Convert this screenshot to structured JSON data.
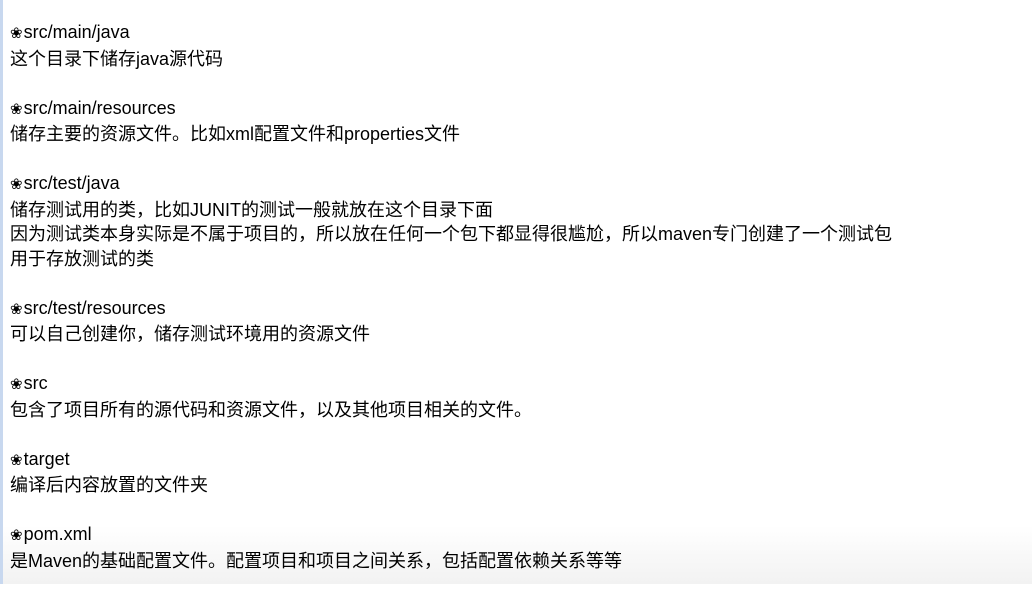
{
  "bullet_icon": "❀",
  "sections": [
    {
      "title": "src/main/java",
      "lines": [
        "这个目录下储存java源代码"
      ]
    },
    {
      "title": "src/main/resources",
      "lines": [
        "储存主要的资源文件。比如xml配置文件和properties文件"
      ]
    },
    {
      "title": "src/test/java",
      "lines": [
        "储存测试用的类，比如JUNIT的测试一般就放在这个目录下面",
        "因为测试类本身实际是不属于项目的，所以放在任何一个包下都显得很尴尬，所以maven专门创建了一个测试包",
        "用于存放测试的类"
      ]
    },
    {
      "title": "src/test/resources",
      "lines": [
        "可以自己创建你，储存测试环境用的资源文件"
      ]
    },
    {
      "title": "src",
      "lines": [
        "包含了项目所有的源代码和资源文件，以及其他项目相关的文件。"
      ]
    },
    {
      "title": "target",
      "lines": [
        "编译后内容放置的文件夹"
      ]
    },
    {
      "title": "pom.xml",
      "lines": [
        "是Maven的基础配置文件。配置项目和项目之间关系，包括配置依赖关系等等"
      ]
    }
  ]
}
